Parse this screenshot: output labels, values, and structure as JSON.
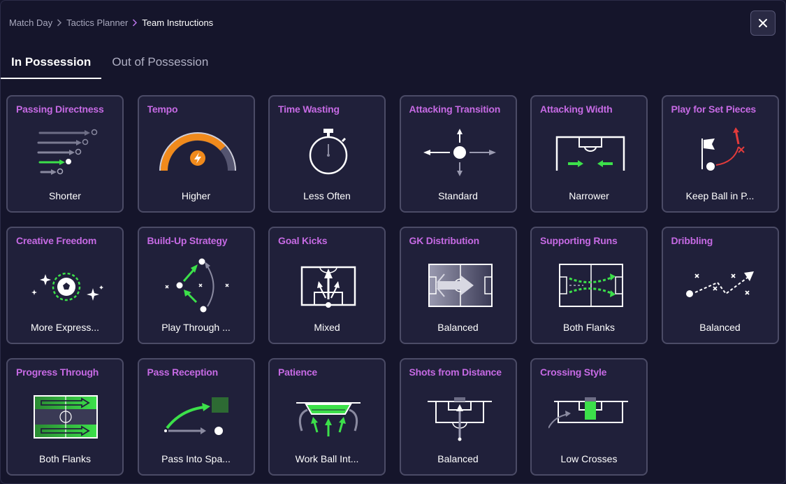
{
  "breadcrumb": {
    "items": [
      "Match Day",
      "Tactics Planner",
      "Team Instructions"
    ]
  },
  "tabs": [
    {
      "label": "In Possession",
      "active": true
    },
    {
      "label": "Out of Possession",
      "active": false
    }
  ],
  "cards": [
    {
      "title": "Passing Directness",
      "value": "Shorter",
      "icon": "passing-directness-icon"
    },
    {
      "title": "Tempo",
      "value": "Higher",
      "icon": "tempo-gauge-icon"
    },
    {
      "title": "Time Wasting",
      "value": "Less Often",
      "icon": "stopwatch-icon"
    },
    {
      "title": "Attacking Transition",
      "value": "Standard",
      "icon": "transition-arrows-icon"
    },
    {
      "title": "Attacking Width",
      "value": "Narrower",
      "icon": "attacking-width-icon"
    },
    {
      "title": "Play for Set Pieces",
      "value": "Keep Ball in P...",
      "icon": "corner-flag-icon"
    },
    {
      "title": "Creative Freedom",
      "value": "More Express...",
      "icon": "sparkle-ball-icon"
    },
    {
      "title": "Build-Up Strategy",
      "value": "Play Through ...",
      "icon": "build-up-icon"
    },
    {
      "title": "Goal Kicks",
      "value": "Mixed",
      "icon": "goal-kick-icon"
    },
    {
      "title": "GK Distribution",
      "value": "Balanced",
      "icon": "gk-distribution-icon"
    },
    {
      "title": "Supporting Runs",
      "value": "Both Flanks",
      "icon": "supporting-runs-icon"
    },
    {
      "title": "Dribbling",
      "value": "Balanced",
      "icon": "dribbling-icon"
    },
    {
      "title": "Progress Through",
      "value": "Both Flanks",
      "icon": "progress-pitch-icon"
    },
    {
      "title": "Pass Reception",
      "value": "Pass Into Spa...",
      "icon": "pass-reception-icon"
    },
    {
      "title": "Patience",
      "value": "Work Ball Int...",
      "icon": "patience-icon"
    },
    {
      "title": "Shots from Distance",
      "value": "Balanced",
      "icon": "shots-distance-icon"
    },
    {
      "title": "Crossing Style",
      "value": "Low Crosses",
      "icon": "crossing-style-icon"
    }
  ],
  "colors": {
    "background": "#15152b",
    "card": "#20203a",
    "card_border": "#4b4b66",
    "title_accent": "#c66ae4",
    "green": "#3ce04a",
    "orange": "#f08a1c",
    "red": "#e23b3b"
  }
}
